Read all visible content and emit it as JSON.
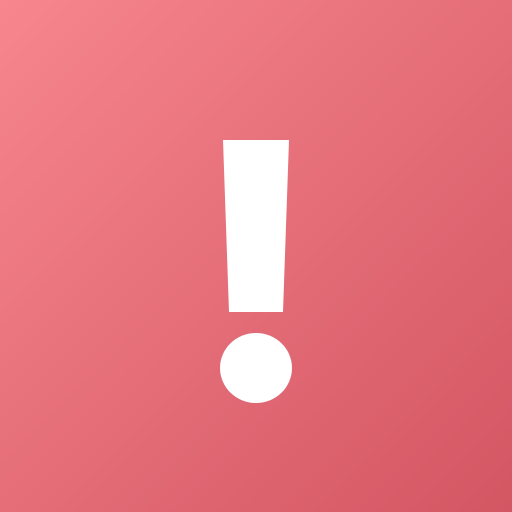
{
  "icon": {
    "name": "exclamation-mark-icon",
    "meaning": "alert"
  },
  "colors": {
    "background_start": "#F7868E",
    "background_end": "#D35663",
    "glyph": "#FFFFFF"
  }
}
